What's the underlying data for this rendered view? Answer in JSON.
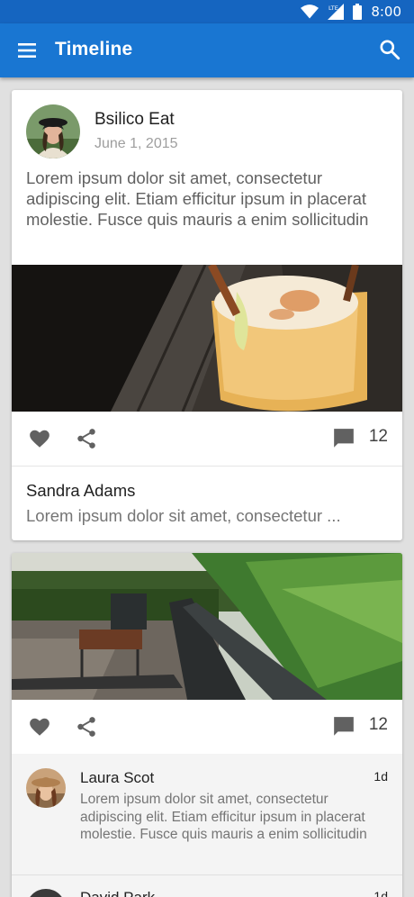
{
  "status_bar": {
    "network": "LTE",
    "time": "8:00"
  },
  "app_bar": {
    "title": "Timeline"
  },
  "posts": [
    {
      "author": "Bsilico Eat",
      "date": "June 1, 2015",
      "body": "Lorem ipsum dolor sit amet, consectetur adipiscing elit. Etiam efficitur ipsum in placerat molestie.  Fusce quis mauris a enim sollicitudin",
      "comment_count": "12",
      "top_comment": {
        "author": "Sandra Adams",
        "text": "Lorem ipsum dolor sit amet, consectetur ..."
      }
    },
    {
      "comment_count": "12",
      "comments": [
        {
          "author": "Laura Scot",
          "time": "1d",
          "text": "Lorem ipsum dolor sit amet, consectetur adipiscing elit. Etiam efficitur ipsum in placerat molestie.  Fusce quis mauris a enim sollicitudin"
        },
        {
          "author": "David Park",
          "time": "1d"
        }
      ]
    }
  ],
  "icons": {
    "status": [
      "wifi-icon",
      "signal-icon",
      "battery-icon"
    ],
    "app_bar": [
      "menu-icon",
      "search-icon"
    ],
    "actions": [
      "heart-icon",
      "share-icon",
      "comment-icon"
    ]
  },
  "colors": {
    "status_bar": "#1565c0",
    "app_bar": "#1976d2",
    "icon_grey": "#616161",
    "background": "#e0e0e0"
  }
}
